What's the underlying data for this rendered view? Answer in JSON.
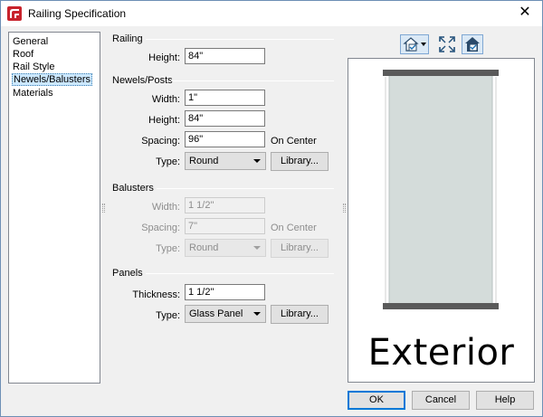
{
  "window": {
    "title": "Railing Specification",
    "app_icon": "chief-architect-logo-icon",
    "close_icon": "close-icon"
  },
  "nav": {
    "items": [
      "General",
      "Roof",
      "Rail Style",
      "Newels/Balusters",
      "Materials"
    ],
    "selected": "Newels/Balusters"
  },
  "railing": {
    "title": "Railing",
    "height_label": "Height:",
    "height_value": "84\""
  },
  "newels": {
    "title": "Newels/Posts",
    "width_label": "Width:",
    "width_value": "1\"",
    "height_label": "Height:",
    "height_value": "84\"",
    "spacing_label": "Spacing:",
    "spacing_value": "96\"",
    "spacing_suffix": "On Center",
    "type_label": "Type:",
    "type_value": "Round",
    "library_label": "Library..."
  },
  "balusters": {
    "title": "Balusters",
    "width_label": "Width:",
    "width_value": "1 1/2\"",
    "spacing_label": "Spacing:",
    "spacing_value": "7\"",
    "spacing_suffix": "On Center",
    "type_label": "Type:",
    "type_value": "Round",
    "library_label": "Library..."
  },
  "panels": {
    "title": "Panels",
    "thickness_label": "Thickness:",
    "thickness_value": "1 1/2\"",
    "type_label": "Type:",
    "type_value": "Glass Panel",
    "library_label": "Library..."
  },
  "preview": {
    "caption": "Exterior",
    "toolbar_icons": [
      "view-options-icon",
      "fill-window-icon",
      "show-surfaces-icon"
    ]
  },
  "buttons": {
    "ok": "OK",
    "cancel": "Cancel",
    "help": "Help"
  },
  "colors": {
    "selection_bg": "#cce8ff",
    "default_button_border": "#0078d7",
    "panel_glass": "#d4dcda",
    "rail_bar": "#5a5a5a",
    "logo_red": "#c8232c"
  }
}
